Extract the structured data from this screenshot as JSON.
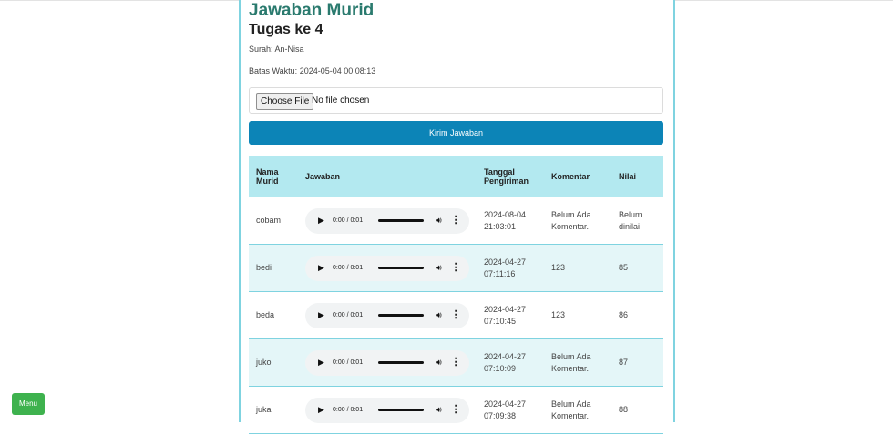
{
  "header": {
    "title": "Jawaban Murid",
    "subtitle": "Tugas ke 4"
  },
  "meta": {
    "surah": "Surah: An-Nisa",
    "deadline": "Batas Waktu: 2024-05-04 00:08:13"
  },
  "upload": {
    "button_label": "Choose File",
    "status_text": "No file chosen"
  },
  "submit_label": "Kirim Jawaban",
  "table": {
    "headers": {
      "name": "Nama Murid",
      "answer": "Jawaban",
      "date": "Tanggal Pengiriman",
      "comment": "Komentar",
      "score": "Nilai"
    },
    "rows": [
      {
        "name": "cobam",
        "audio_time": "0:00 / 0:01",
        "date": "2024-08-04 21:03:01",
        "comment": "Belum Ada Komentar.",
        "score": "Belum dinilai"
      },
      {
        "name": "bedi",
        "audio_time": "0:00 / 0:01",
        "date": "2024-04-27 07:11:16",
        "comment": "123",
        "score": "85"
      },
      {
        "name": "beda",
        "audio_time": "0:00 / 0:01",
        "date": "2024-04-27 07:10:45",
        "comment": "123",
        "score": "86"
      },
      {
        "name": "juko",
        "audio_time": "0:00 / 0:01",
        "date": "2024-04-27 07:10:09",
        "comment": "Belum Ada Komentar.",
        "score": "87"
      },
      {
        "name": "juka",
        "audio_time": "0:00 / 0:01",
        "date": "2024-04-27 07:09:38",
        "comment": "Belum Ada Komentar.",
        "score": "88"
      }
    ]
  },
  "menu_label": "Menu",
  "colors": {
    "title": "#2a7a6e",
    "submit": "#0c84b7",
    "table_header": "#b3e9f0",
    "row_alt": "#e4f6f8",
    "border": "#7fd3e0",
    "menu": "#3eb24e"
  },
  "icons": {
    "play": "play-icon",
    "volume": "volume-icon",
    "more": "more-options-icon"
  }
}
